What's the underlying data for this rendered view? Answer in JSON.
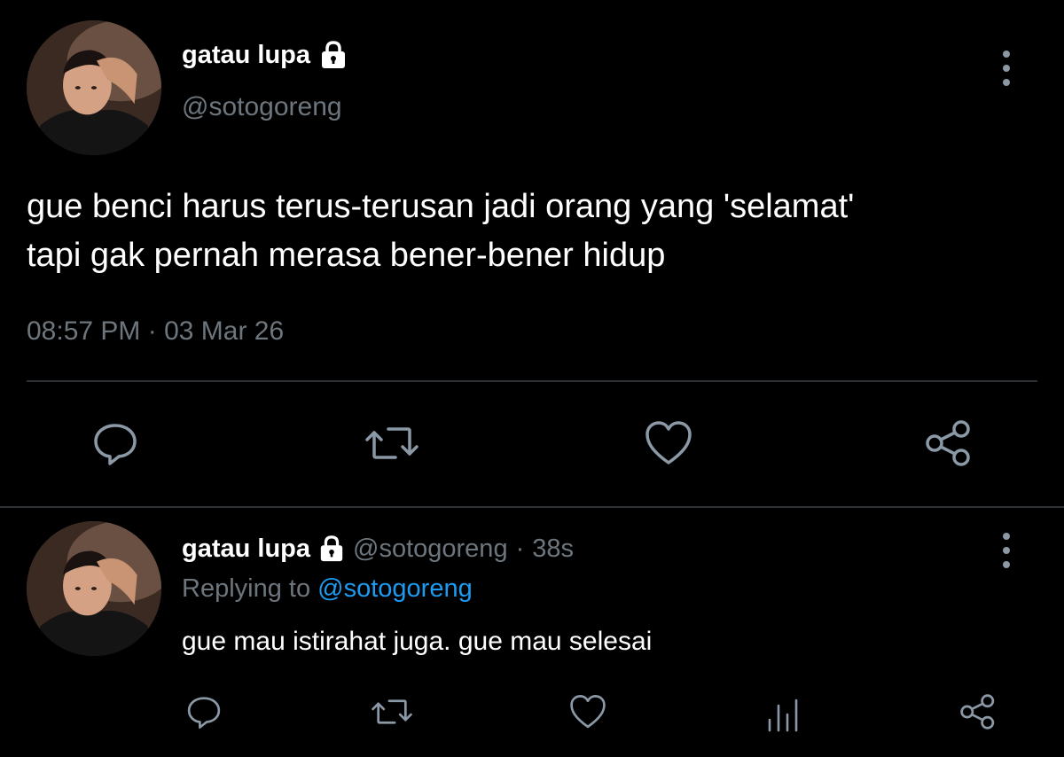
{
  "main_tweet": {
    "display_name": "gatau lupa",
    "handle": "@sotogoreng",
    "text_line1": "gue benci harus terus-terusan jadi orang yang 'selamat'",
    "text_line2": "tapi gak pernah merasa bener-bener hidup",
    "timestamp": "08:57 PM · 03 Mar 26",
    "actions": [
      "reply-icon",
      "retweet-icon",
      "like-icon",
      "share-icon"
    ]
  },
  "reply_tweet": {
    "display_name": "gatau lupa",
    "handle": "@sotogoreng",
    "separator": "·",
    "time_ago": "38s",
    "replying_prefix": "Replying to",
    "replying_handle": "@sotogoreng",
    "text": "gue mau istirahat juga. gue mau selesai",
    "actions": [
      "reply-icon",
      "retweet-icon",
      "like-icon",
      "analytics-icon",
      "share-icon"
    ]
  },
  "colors": {
    "background": "#000000",
    "text": "#ffffff",
    "muted": "#6e767d",
    "link": "#1d9bf0",
    "divider": "#2f3336",
    "icon": "#8b98a5"
  }
}
